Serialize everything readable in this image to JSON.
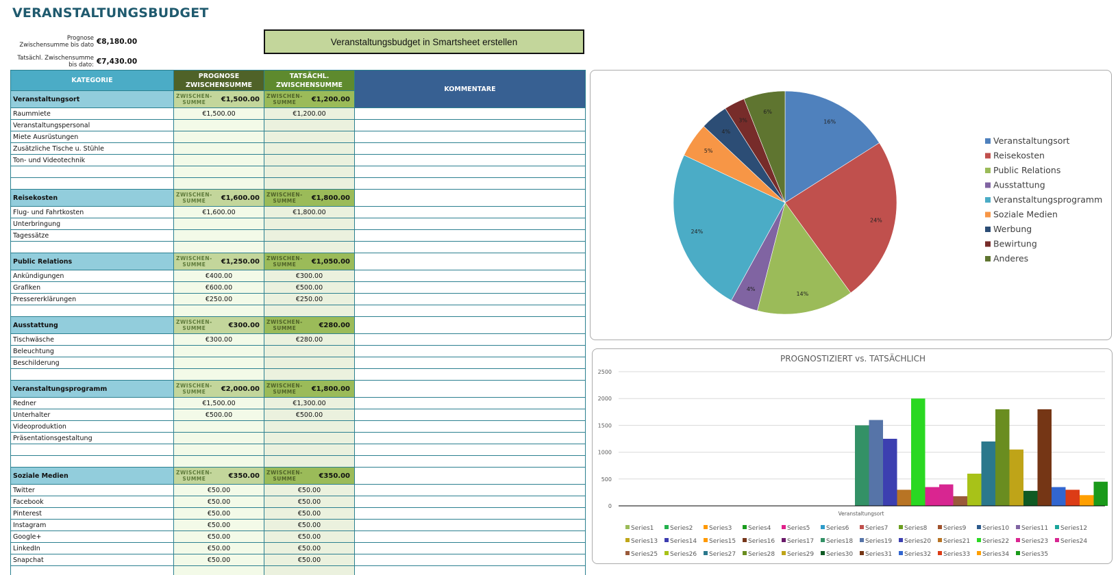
{
  "header": {
    "title": "VERANSTALTUNGSBUDGET",
    "forecast_label_line1": "Prognose",
    "forecast_label_line2": "Zwischensumme bis dato",
    "forecast_value": "€8,180.00",
    "actual_label_line1": "Tatsächl. Zwischensumme",
    "actual_label_line2": "bis dato:",
    "actual_value": "€7,430.00",
    "smartsheet_button": "Veranstaltungsbudget in Smartsheet erstellen"
  },
  "table": {
    "headers": {
      "category": "KATEGORIE",
      "forecast_line1": "PROGNOSE",
      "forecast_line2": "ZWISCHENSUMME",
      "actual_line1": "TATSÄCHL.",
      "actual_line2": "ZWISCHENSUMME",
      "comments": "KOMMENTARE"
    },
    "subtotal_label_line1": "ZWISCHEN-",
    "subtotal_label_line2": "SUMME",
    "sections": [
      {
        "name": "Veranstaltungsort",
        "forecast": "€1,500.00",
        "actual": "€1,200.00",
        "items": [
          {
            "label": "Raummiete",
            "forecast": "€1,500.00",
            "actual": "€1,200.00"
          },
          {
            "label": "Veranstaltungspersonal",
            "forecast": "",
            "actual": ""
          },
          {
            "label": "Miete Ausrüstungen",
            "forecast": "",
            "actual": ""
          },
          {
            "label": "Zusätzliche Tische u. Stühle",
            "forecast": "",
            "actual": ""
          },
          {
            "label": "Ton- und Videotechnik",
            "forecast": "",
            "actual": ""
          },
          {
            "label": "",
            "forecast": "",
            "actual": ""
          },
          {
            "label": "",
            "forecast": "",
            "actual": ""
          }
        ]
      },
      {
        "name": "Reisekosten",
        "forecast": "€1,600.00",
        "actual": "€1,800.00",
        "items": [
          {
            "label": "Flug- und Fahrtkosten",
            "forecast": "€1,600.00",
            "actual": "€1,800.00"
          },
          {
            "label": "Unterbringung",
            "forecast": "",
            "actual": ""
          },
          {
            "label": "Tagessätze",
            "forecast": "",
            "actual": ""
          },
          {
            "label": "",
            "forecast": "",
            "actual": ""
          }
        ]
      },
      {
        "name": "Public Relations",
        "forecast": "€1,250.00",
        "actual": "€1,050.00",
        "items": [
          {
            "label": "Ankündigungen",
            "forecast": "€400.00",
            "actual": "€300.00"
          },
          {
            "label": "Grafiken",
            "forecast": "€600.00",
            "actual": "€500.00"
          },
          {
            "label": "Pressererklärungen",
            "forecast": "€250.00",
            "actual": "€250.00"
          },
          {
            "label": "",
            "forecast": "",
            "actual": ""
          }
        ]
      },
      {
        "name": "Ausstattung",
        "forecast": "€300.00",
        "actual": "€280.00",
        "items": [
          {
            "label": "Tischwäsche",
            "forecast": "€300.00",
            "actual": "€280.00"
          },
          {
            "label": "Beleuchtung",
            "forecast": "",
            "actual": ""
          },
          {
            "label": "Beschilderung",
            "forecast": "",
            "actual": ""
          },
          {
            "label": "",
            "forecast": "",
            "actual": ""
          }
        ]
      },
      {
        "name": "Veranstaltungsprogramm",
        "forecast": "€2,000.00",
        "actual": "€1,800.00",
        "items": [
          {
            "label": "Redner",
            "forecast": "€1,500.00",
            "actual": "€1,300.00"
          },
          {
            "label": "Unterhalter",
            "forecast": "€500.00",
            "actual": "€500.00"
          },
          {
            "label": "Videoproduktion",
            "forecast": "",
            "actual": ""
          },
          {
            "label": "Präsentationsgestaltung",
            "forecast": "",
            "actual": ""
          },
          {
            "label": "",
            "forecast": "",
            "actual": ""
          },
          {
            "label": "",
            "forecast": "",
            "actual": ""
          }
        ]
      },
      {
        "name": "Soziale Medien",
        "forecast": "€350.00",
        "actual": "€350.00",
        "items": [
          {
            "label": "Twitter",
            "forecast": "€50.00",
            "actual": "€50.00"
          },
          {
            "label": "Facebook",
            "forecast": "€50.00",
            "actual": "€50.00"
          },
          {
            "label": "Pinterest",
            "forecast": "€50.00",
            "actual": "€50.00"
          },
          {
            "label": "Instagram",
            "forecast": "€50.00",
            "actual": "€50.00"
          },
          {
            "label": "Google+",
            "forecast": "€50.00",
            "actual": "€50.00"
          },
          {
            "label": "LinkedIn",
            "forecast": "€50.00",
            "actual": "€50.00"
          },
          {
            "label": "Snapchat",
            "forecast": "€50.00",
            "actual": "€50.00"
          },
          {
            "label": "",
            "forecast": "",
            "actual": ""
          }
        ]
      }
    ]
  },
  "chart_data": [
    {
      "type": "pie",
      "title": "",
      "legend_position": "right",
      "categories": [
        "Veranstaltungsort",
        "Reisekosten",
        "Public Relations",
        "Ausstattung",
        "Veranstaltungsprogramm",
        "Soziale Medien",
        "Werbung",
        "Bewirtung",
        "Anderes"
      ],
      "values": [
        16,
        24,
        14,
        4,
        24,
        5,
        4,
        3,
        6
      ],
      "labels": [
        "16%",
        "24%",
        "14%",
        "4%",
        "24%",
        "5%",
        "4%",
        "3%",
        "6%"
      ],
      "colors": [
        "#4f81bd",
        "#c0504d",
        "#9bbb59",
        "#8064a2",
        "#4bacc6",
        "#f79646",
        "#2c4d75",
        "#772c2a",
        "#5f7530"
      ]
    },
    {
      "type": "bar",
      "title": "PROGNOSTIZIERT vs. TATSÄCHLICH",
      "xlabel": "",
      "ylabel": "",
      "categories": [
        "Veranstaltungsort"
      ],
      "ylim": [
        0,
        2500
      ],
      "yticks": [
        "0",
        "500",
        "1000",
        "1500",
        "2000",
        "2500"
      ],
      "grid": true,
      "legend_position": "bottom",
      "series": [
        {
          "name": "Series1",
          "color": "#9bbb59",
          "values": [
            0
          ]
        },
        {
          "name": "Series2",
          "color": "#23b14d",
          "values": [
            0
          ]
        },
        {
          "name": "Series3",
          "color": "#ff9900",
          "values": [
            0
          ]
        },
        {
          "name": "Series4",
          "color": "#199c1d",
          "values": [
            0
          ]
        },
        {
          "name": "Series5",
          "color": "#e0218a",
          "values": [
            0
          ]
        },
        {
          "name": "Series6",
          "color": "#2e9cca",
          "values": [
            0
          ]
        },
        {
          "name": "Series7",
          "color": "#c0504d",
          "values": [
            0
          ]
        },
        {
          "name": "Series8",
          "color": "#6b9e1f",
          "values": [
            0
          ]
        },
        {
          "name": "Series9",
          "color": "#a0522d",
          "values": [
            0
          ]
        },
        {
          "name": "Series10",
          "color": "#2c5a8c",
          "values": [
            0
          ]
        },
        {
          "name": "Series11",
          "color": "#8064a2",
          "values": [
            0
          ]
        },
        {
          "name": "Series12",
          "color": "#1aa59b",
          "values": [
            0
          ]
        },
        {
          "name": "Series13",
          "color": "#bfa618",
          "values": [
            0
          ]
        },
        {
          "name": "Series14",
          "color": "#3c3cb0",
          "values": [
            0
          ]
        },
        {
          "name": "Series15",
          "color": "#ff9900",
          "values": [
            0
          ]
        },
        {
          "name": "Series16",
          "color": "#76361a",
          "values": [
            0
          ]
        },
        {
          "name": "Series17",
          "color": "#6a1a6a",
          "values": [
            0
          ]
        },
        {
          "name": "Series18",
          "color": "#339166",
          "values": [
            1500
          ]
        },
        {
          "name": "Series19",
          "color": "#5674a8",
          "values": [
            1600
          ]
        },
        {
          "name": "Series20",
          "color": "#3c3fb0",
          "values": [
            1250
          ]
        },
        {
          "name": "Series21",
          "color": "#b87424",
          "values": [
            300
          ]
        },
        {
          "name": "Series22",
          "color": "#2ad822",
          "values": [
            2000
          ]
        },
        {
          "name": "Series23",
          "color": "#da2590",
          "values": [
            350
          ]
        },
        {
          "name": "Series24",
          "color": "#d72691",
          "values": [
            400
          ]
        },
        {
          "name": "Series25",
          "color": "#9a5a3a",
          "values": [
            180
          ]
        },
        {
          "name": "Series26",
          "color": "#a8c218",
          "values": [
            600
          ]
        },
        {
          "name": "Series27",
          "color": "#2b788c",
          "values": [
            1200
          ]
        },
        {
          "name": "Series28",
          "color": "#6a8d20",
          "values": [
            1800
          ]
        },
        {
          "name": "Series29",
          "color": "#bfa418",
          "values": [
            1050
          ]
        },
        {
          "name": "Series30",
          "color": "#0f5a24",
          "values": [
            280
          ]
        },
        {
          "name": "Series31",
          "color": "#753615",
          "values": [
            1800
          ]
        },
        {
          "name": "Series32",
          "color": "#3266d0",
          "values": [
            350
          ]
        },
        {
          "name": "Series33",
          "color": "#dc3c16",
          "values": [
            300
          ]
        },
        {
          "name": "Series34",
          "color": "#ff9f00",
          "values": [
            200
          ]
        },
        {
          "name": "Series35",
          "color": "#1a9a1a",
          "values": [
            450
          ]
        }
      ]
    }
  ]
}
